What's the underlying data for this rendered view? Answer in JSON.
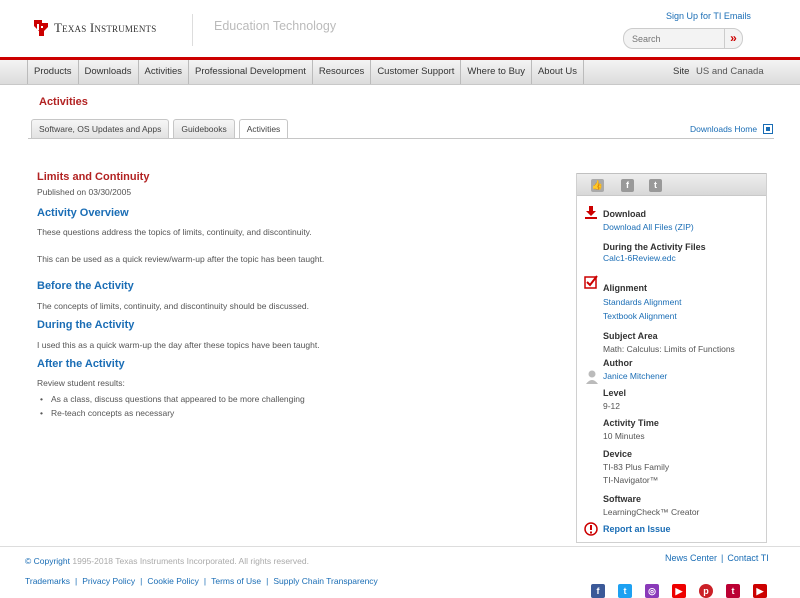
{
  "header": {
    "brand": "Texas Instruments",
    "section": "Education Technology",
    "signup": "Sign Up for TI Emails",
    "search_placeholder": "Search",
    "search_go": "»"
  },
  "nav": {
    "items": [
      "Products",
      "Downloads",
      "Activities",
      "Professional Development",
      "Resources",
      "Customer Support",
      "Where to Buy",
      "About Us"
    ],
    "site_label": "Site",
    "site_value": "US and Canada"
  },
  "page_heading": "Activities",
  "tabs": [
    "Software, OS Updates and Apps",
    "Guidebooks",
    "Activities"
  ],
  "downloads_home": "Downloads Home",
  "main": {
    "title": "Limits and Continuity",
    "published": "Published on 03/30/2005",
    "overview_h": "Activity Overview",
    "overview_p1": "These questions address the topics of limits, continuity, and discontinuity.",
    "overview_p2": "This can be used as a quick review/warm-up after the topic has been taught.",
    "before_h": "Before the Activity",
    "before_p": "The concepts of limits, continuity, and discontinuity should be discussed.",
    "during_h": "During the Activity",
    "during_p": "I used this as a quick warm-up the day after these topics have been taught.",
    "after_h": "After the Activity",
    "after_p": "Review student results:",
    "after_list": [
      "As a class, discuss questions that appeared to be more challenging",
      "Re-teach concepts as necessary"
    ]
  },
  "sidebar": {
    "download_h": "Download",
    "download_all": "Download All Files (ZIP)",
    "during_files_h": "During the Activity Files",
    "during_file": "Calc1-6Review.edc",
    "alignment_h": "Alignment",
    "standards": "Standards Alignment",
    "textbook": "Textbook Alignment",
    "subject_h": "Subject Area",
    "subject_v": "Math: Calculus: Limits of Functions",
    "author_h": "Author",
    "author_v": "Janice Mitchener",
    "level_h": "Level",
    "level_v": "9-12",
    "time_h": "Activity Time",
    "time_v": "10 Minutes",
    "device_h": "Device",
    "device_v1": "TI-83 Plus Family",
    "device_v2": "TI-Navigator™",
    "software_h": "Software",
    "software_v": "LearningCheck™ Creator",
    "report": "Report an Issue"
  },
  "footer": {
    "copyright_symbol": "© Copyright",
    "copyright_text": "1995-2018 Texas Instruments Incorporated. All rights reserved.",
    "news": "News Center",
    "contact": "Contact TI",
    "sep": "|",
    "links": [
      "Trademarks",
      "Privacy Policy",
      "Cookie Policy",
      "Terms of Use",
      "Supply Chain Transparency"
    ]
  },
  "colors": {
    "accent_red": "#b22222",
    "link_blue": "#1a6db5"
  },
  "icons": [
    "ti-logo-icon",
    "thumbs-up-icon",
    "facebook-icon",
    "twitter-icon",
    "download-icon",
    "checkmark-icon",
    "author-icon",
    "report-issue-icon",
    "instagram-icon",
    "youtube-icon",
    "pinterest-icon",
    "tumblr-icon"
  ]
}
